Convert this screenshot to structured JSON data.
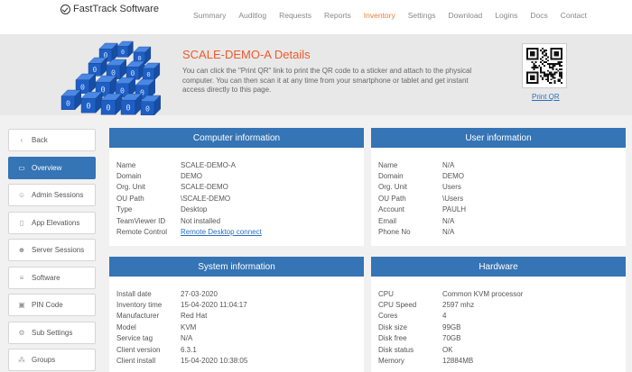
{
  "app": {
    "name": "FastTrack Software"
  },
  "nav": [
    "Summary",
    "Auditlog",
    "Requests",
    "Reports",
    "Inventory",
    "Settings",
    "Download",
    "Logins",
    "Docs",
    "Contact"
  ],
  "nav_active": "Inventory",
  "banner": {
    "title": "SCALE-DEMO-A Details",
    "text": "You can click the \"Print QR\" link to print the QR code to a sticker and attach to the physical computer. You can then scan it at any time from your smartphone or tablet and get instant access directly to this page.",
    "print_qr": "Print QR"
  },
  "sidebar": [
    {
      "label": "Back",
      "icon": "chevron-left-icon",
      "glyph": "‹",
      "active": false
    },
    {
      "label": "Overview",
      "icon": "laptop-icon",
      "glyph": "▭",
      "active": true
    },
    {
      "label": "Admin Sessions",
      "icon": "user-icon",
      "glyph": "☺",
      "active": false
    },
    {
      "label": "App Elevations",
      "icon": "document-icon",
      "glyph": "▯",
      "active": false
    },
    {
      "label": "Server Sessions",
      "icon": "user-group-icon",
      "glyph": "☻",
      "active": false
    },
    {
      "label": "Software",
      "icon": "database-icon",
      "glyph": "≡",
      "active": false
    },
    {
      "label": "PIN Code",
      "icon": "lock-icon",
      "glyph": "▣",
      "active": false
    },
    {
      "label": "Sub Settings",
      "icon": "gear-icon",
      "glyph": "⚙",
      "active": false
    },
    {
      "label": "Groups",
      "icon": "group-icon",
      "glyph": "⁂",
      "active": false
    }
  ],
  "computer": {
    "title": "Computer information",
    "rows": [
      {
        "k": "Name",
        "v": "SCALE-DEMO-A"
      },
      {
        "k": "Domain",
        "v": "DEMO"
      },
      {
        "k": "Org. Unit",
        "v": "SCALE-DEMO"
      },
      {
        "k": "OU Path",
        "v": "\\SCALE-DEMO"
      },
      {
        "k": "Type",
        "v": "Desktop"
      },
      {
        "k": "TeamViewer ID",
        "v": "Not installed"
      },
      {
        "k": "Remote Control",
        "v": "Remote Desktop connect",
        "link": true
      }
    ]
  },
  "user": {
    "title": "User information",
    "rows": [
      {
        "k": "Name",
        "v": "N/A"
      },
      {
        "k": "Domain",
        "v": "DEMO"
      },
      {
        "k": "Org. Unit",
        "v": "Users"
      },
      {
        "k": "OU Path",
        "v": "\\Users"
      },
      {
        "k": "Account",
        "v": "PAULH"
      },
      {
        "k": "Email",
        "v": "N/A"
      },
      {
        "k": "Phone No",
        "v": "N/A"
      }
    ]
  },
  "system": {
    "title": "System information",
    "rows": [
      {
        "k": "Install date",
        "v": "27-03-2020"
      },
      {
        "k": "Inventory time",
        "v": "15-04-2020 11:04:17"
      },
      {
        "k": "Manufacturer",
        "v": "Red Hat"
      },
      {
        "k": "Model",
        "v": "KVM"
      },
      {
        "k": "Service tag",
        "v": "N/A"
      },
      {
        "k": "Client version",
        "v": "6.3.1"
      },
      {
        "k": "Client install",
        "v": "15-04-2020 10:38:05"
      }
    ]
  },
  "hardware": {
    "title": "Hardware",
    "rows": [
      {
        "k": "CPU",
        "v": "Common KVM processor"
      },
      {
        "k": "CPU Speed",
        "v": "2597 mhz"
      },
      {
        "k": "Cores",
        "v": "4"
      },
      {
        "k": "Disk size",
        "v": "99GB"
      },
      {
        "k": "Disk free",
        "v": "70GB"
      },
      {
        "k": "Disk status",
        "v": "OK"
      },
      {
        "k": "Memory",
        "v": "12884MB"
      }
    ]
  },
  "colors": {
    "accent": "#3574b5",
    "nav_active": "#ee7d31",
    "title": "#ee5a2a",
    "link": "#2a6ebb"
  }
}
